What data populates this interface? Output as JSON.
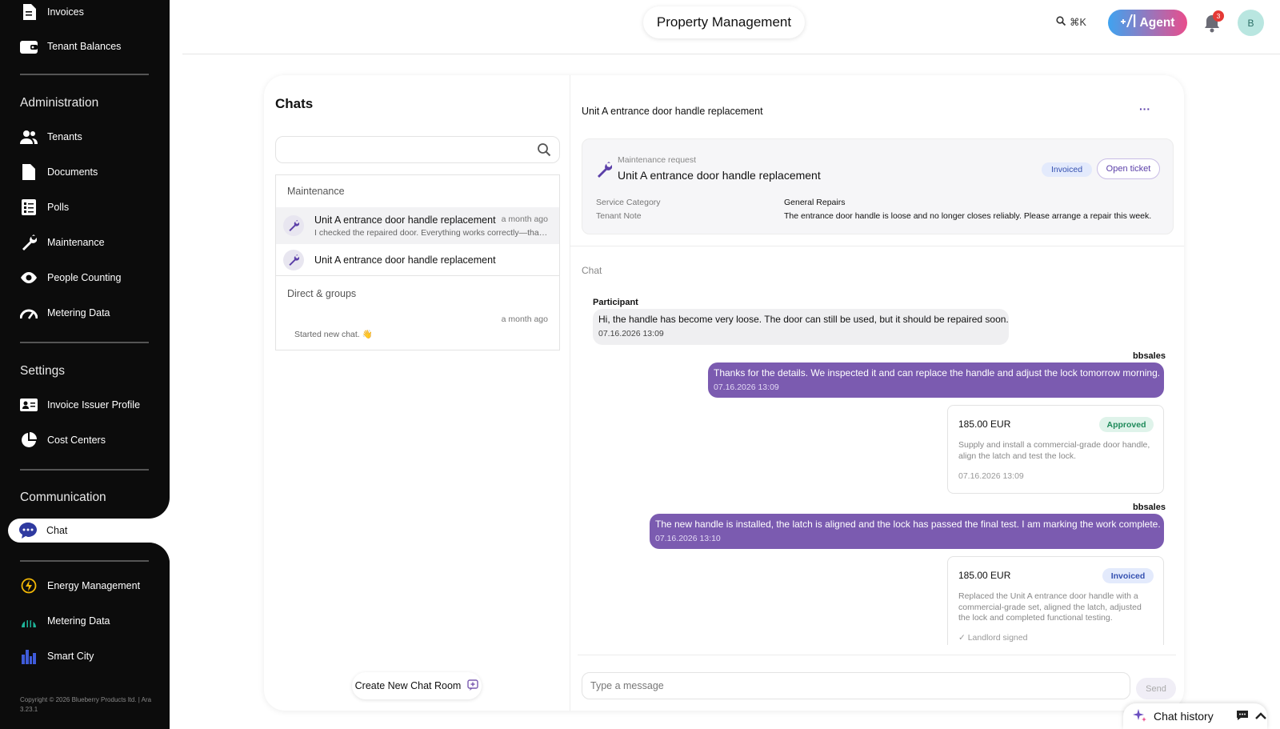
{
  "sidebar": {
    "top_items": [
      {
        "label": "Invoices",
        "icon": "invoice-icon"
      },
      {
        "label": "Tenant Balances",
        "icon": "wallet-icon"
      }
    ],
    "administration": {
      "heading": "Administration",
      "items": [
        {
          "label": "Tenants",
          "icon": "people-icon"
        },
        {
          "label": "Documents",
          "icon": "document-icon"
        },
        {
          "label": "Polls",
          "icon": "checklist-icon"
        },
        {
          "label": "Maintenance",
          "icon": "wrench-icon"
        },
        {
          "label": "People Counting",
          "icon": "eye-icon"
        },
        {
          "label": "Metering Data",
          "icon": "gauge-icon"
        }
      ]
    },
    "settings": {
      "heading": "Settings",
      "items": [
        {
          "label": "Invoice Issuer Profile",
          "icon": "id-card-icon"
        },
        {
          "label": "Cost Centers",
          "icon": "pie-icon"
        }
      ]
    },
    "communication": {
      "heading": "Communication",
      "items": [
        {
          "label": "Chat",
          "icon": "chat-icon",
          "active": true
        }
      ]
    },
    "bottom_items": [
      {
        "label": "Energy Management",
        "icon": "energy-icon"
      },
      {
        "label": "Metering Data",
        "icon": "meter-chart-icon"
      },
      {
        "label": "Smart City",
        "icon": "city-icon"
      }
    ],
    "copyright": "Copyright © 2026 Blueberry Products ltd. | Ara 3.23.1"
  },
  "header": {
    "title": "Property Management",
    "search_shortcut": "⌘K",
    "agent_label": "Agent",
    "notifications_count": "3",
    "avatar_initial": "B"
  },
  "chats": {
    "title": "Chats",
    "search_placeholder": "",
    "sections": {
      "maintenance_label": "Maintenance",
      "direct_label": "Direct & groups"
    },
    "maintenance_rows": [
      {
        "title": "Unit A entrance door handle replacement",
        "time": "a month ago",
        "preview": "I checked the repaired door. Everything works correctly—thank you."
      },
      {
        "title": "Unit A entrance door handle replacement",
        "time": "",
        "preview": ""
      }
    ],
    "direct_rows": [
      {
        "time": "a month ago",
        "preview": "Started new chat. 👋"
      }
    ],
    "create_button": "Create New Chat Room"
  },
  "conversation": {
    "title": "Unit A entrance door handle replacement",
    "more_label": "···",
    "request": {
      "kind": "Maintenance request",
      "title": "Unit A entrance door handle replacement",
      "status": "Invoiced",
      "open_ticket": "Open ticket",
      "fields": [
        {
          "key": "Service Category",
          "value": "General Repairs"
        },
        {
          "key": "Tenant Note",
          "value": "The entrance door handle is loose and no longer closes reliably. Please arrange a repair this week."
        }
      ]
    },
    "chat_label": "Chat",
    "messages": [
      {
        "sender": "Participant",
        "text": "Hi, the handle has become very loose. The door can still be used, but it should be repaired soon.",
        "time": "07.16.2026 13:09"
      },
      {
        "sender": "bbsales",
        "text": "Thanks for the details. We inspected it and can replace the handle and adjust the lock tomorrow morning.",
        "time": "07.16.2026 13:09"
      },
      {
        "sender": "bbsales",
        "text": "The new handle is installed, the latch is aligned and the lock has passed the final test. I am marking the work complete.",
        "time": "07.16.2026 13:10"
      }
    ],
    "quotes": [
      {
        "price": "185.00 EUR",
        "status": "Approved",
        "description": "Supply and install a commercial-grade door handle, align the latch and test the lock.",
        "date": "07.16.2026 13:09"
      },
      {
        "price": "185.00 EUR",
        "status": "Invoiced",
        "description": "Replaced the Unit A entrance door handle with a commercial-grade set, aligned the latch, adjusted the lock and completed functional testing.",
        "date": "✓ Landlord signed"
      }
    ],
    "composer_placeholder": "Type a message",
    "send_label": "Send"
  },
  "chat_history_label": "Chat history",
  "colors": {
    "accent": "#7b5bb0",
    "approved_bg": "#dff3ea",
    "approved_text": "#1e8a5a",
    "invoiced_bg": "#e3eafc",
    "invoiced_text": "#3450b0"
  }
}
